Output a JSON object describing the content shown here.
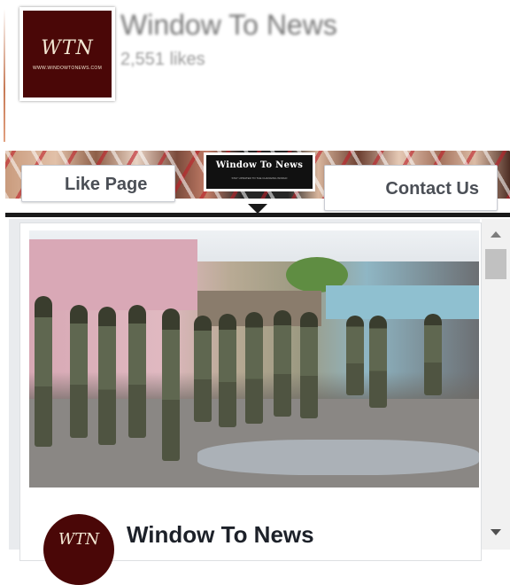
{
  "page": {
    "name": "Window To News",
    "likes": "2,551 likes",
    "logo_text": "WTN",
    "logo_url": "WWW.WINDOWTONEWS.COM"
  },
  "cover": {
    "badge_title": "Window To News",
    "badge_tagline": "STAY UPDATED TO THE CHANGING WORLD"
  },
  "actions": {
    "like_label": "Like Page",
    "contact_label": "Contact Us"
  },
  "post": {
    "photo_icon": "news-photo-soldiers",
    "author_logo": "WTN",
    "author_name": "Window To News"
  },
  "scrollbar": {
    "up_icon": "scroll-up-arrow",
    "down_icon": "scroll-down-arrow"
  },
  "colors": {
    "brand": "#4a0707",
    "button_text": "#4b4f56"
  }
}
